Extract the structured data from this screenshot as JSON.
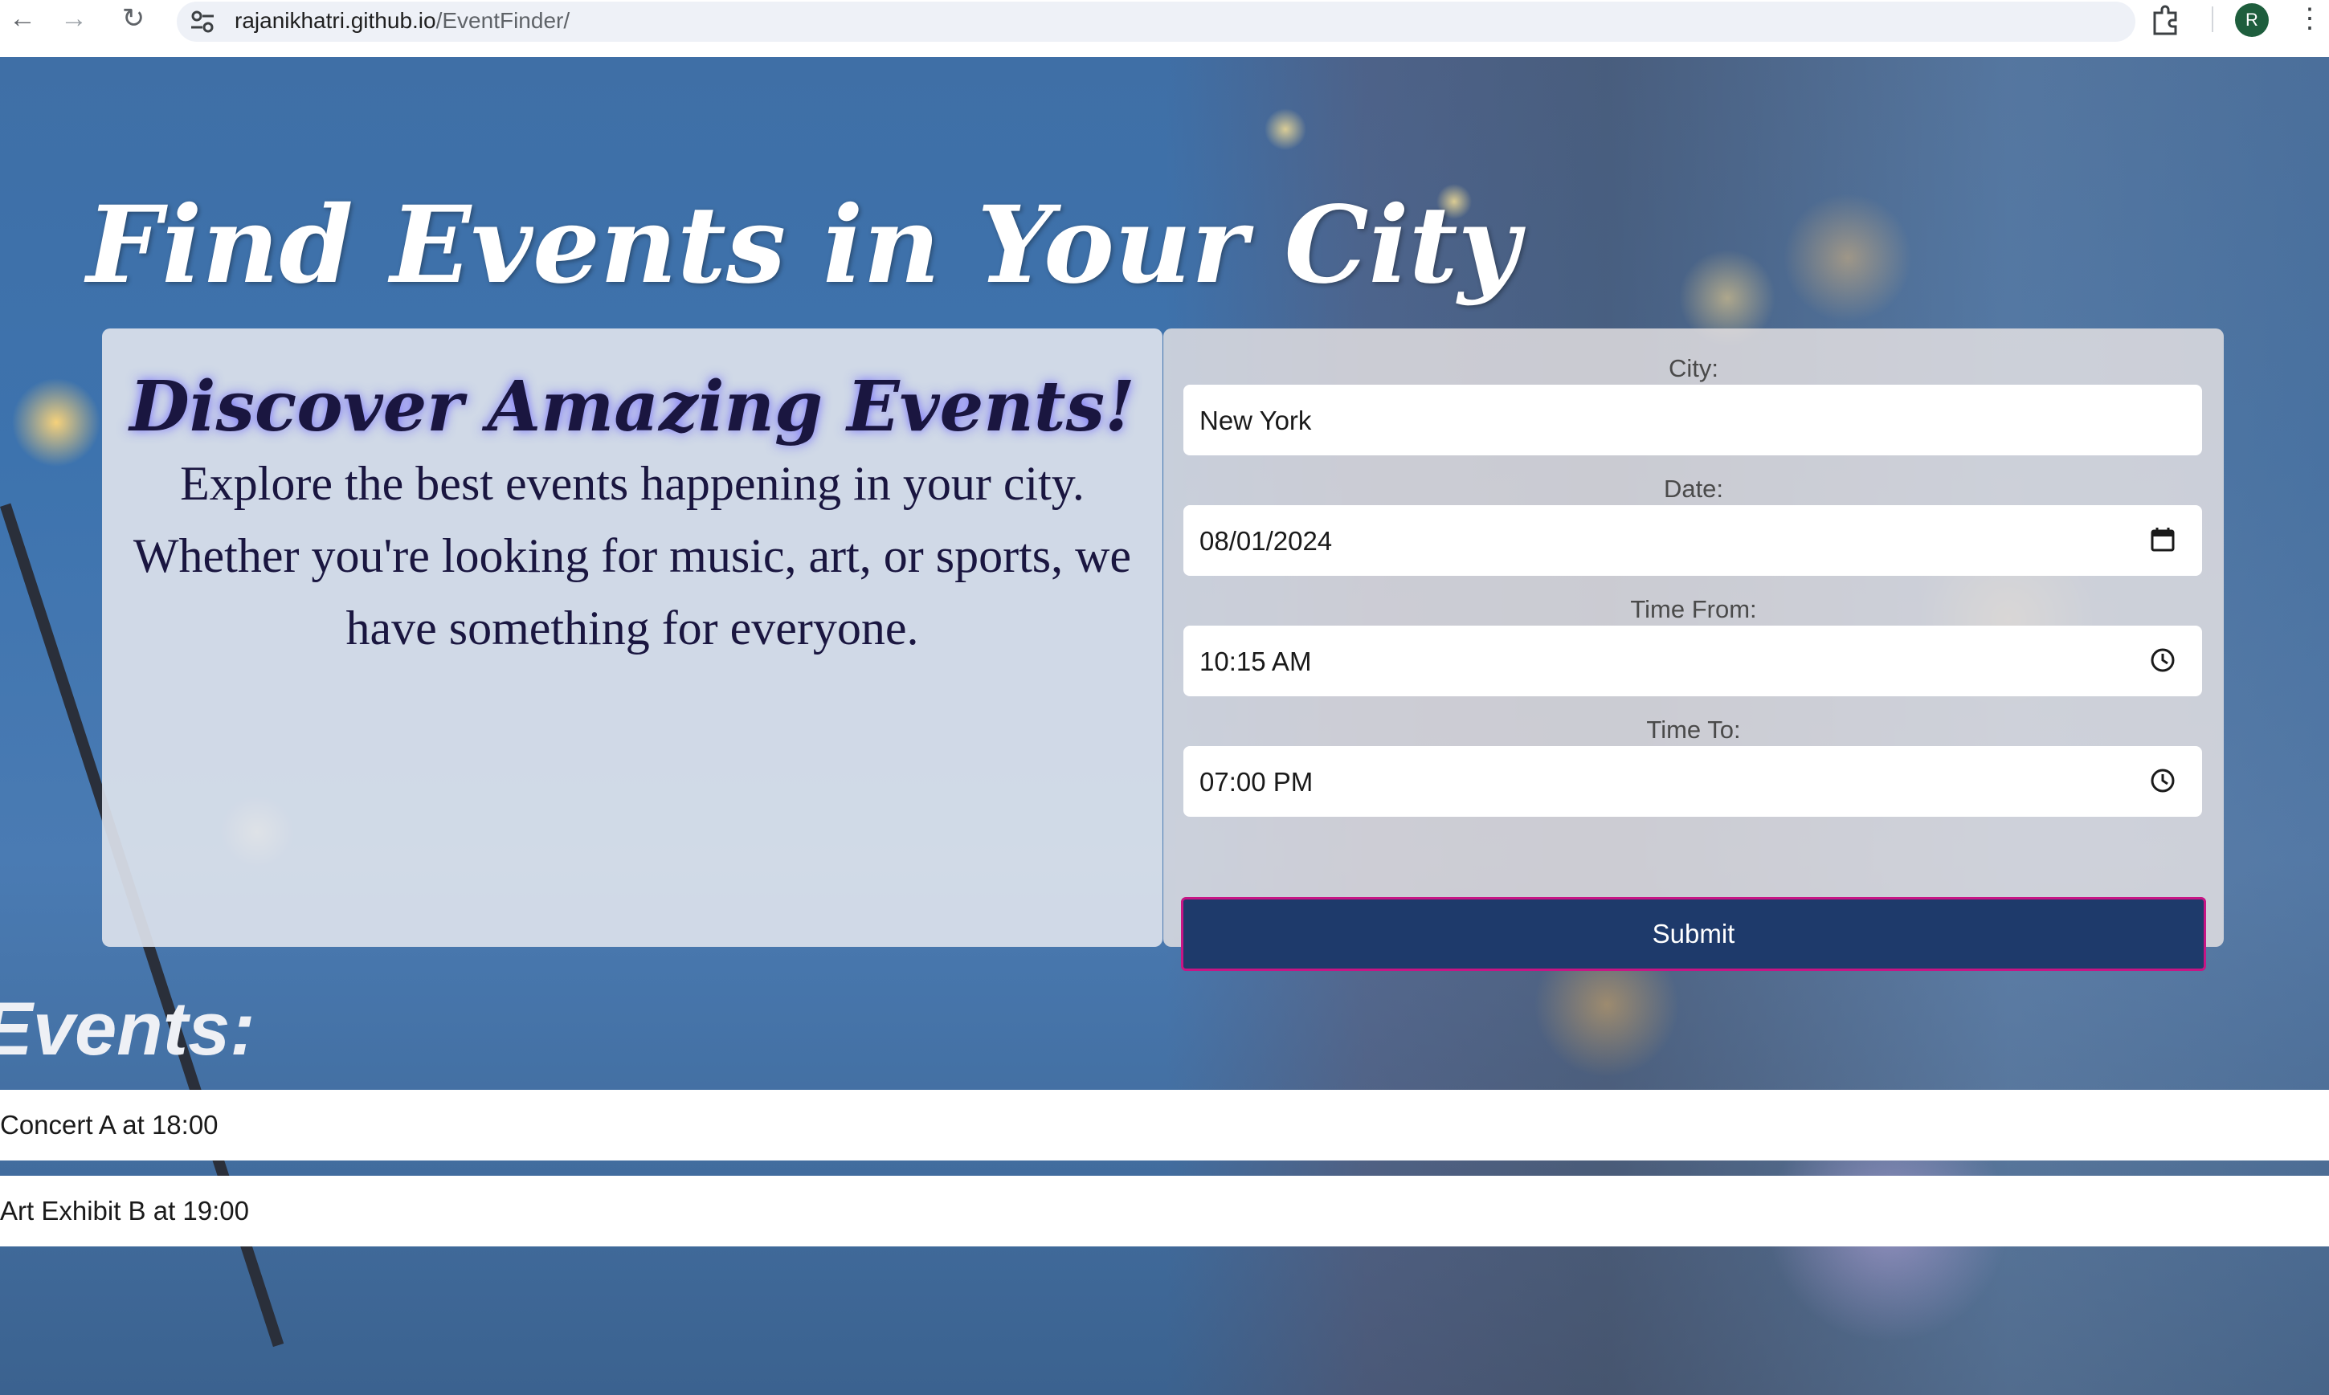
{
  "browser": {
    "url_host": "rajanikhatri.github.io",
    "url_path": "/EventFinder/",
    "profile_initial": "R"
  },
  "hero": {
    "title": "Find Events in Your City"
  },
  "info": {
    "title": "Discover Amazing Events!",
    "text": "Explore the best events happening in your city. Whether you're looking for music, art, or sports, we have something for everyone."
  },
  "form": {
    "city_label": "City:",
    "city_value": "New York",
    "date_label": "Date:",
    "date_value": "08/01/2024",
    "time_from_label": "Time From:",
    "time_from_value": "10:15 AM",
    "time_to_label": "Time To:",
    "time_to_value": "07:00 PM",
    "submit_label": "Submit"
  },
  "events": {
    "heading": "Events:",
    "items": [
      "Concert A at 18:00",
      "Art Exhibit B at 19:00"
    ]
  },
  "colors": {
    "submit_bg": "#1e3a6b",
    "submit_border": "#c71585",
    "info_text": "#1a1640"
  },
  "icons": [
    "back-arrow-icon",
    "forward-arrow-icon",
    "reload-icon",
    "site-settings-icon",
    "star-icon",
    "extensions-icon",
    "menu-dots-icon",
    "calendar-icon",
    "clock-icon"
  ]
}
